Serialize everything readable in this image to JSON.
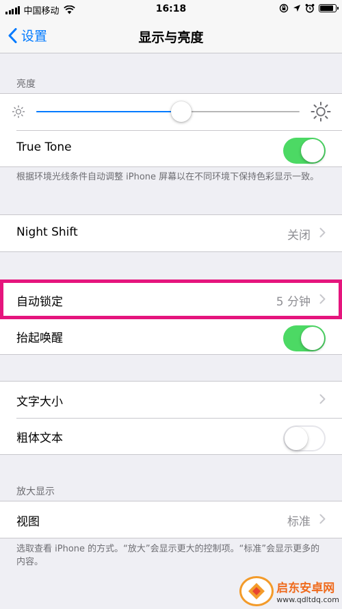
{
  "status_bar": {
    "carrier": "中国移动",
    "time": "16:18"
  },
  "nav": {
    "back_label": "设置",
    "title": "显示与亮度"
  },
  "brightness": {
    "header": "亮度",
    "level": 0.55,
    "true_tone_label": "True Tone",
    "true_tone_on": true,
    "footer": "根据环境光线条件自动调整 iPhone 屏幕以在不同环境下保持色彩显示一致。"
  },
  "night_shift": {
    "label": "Night Shift",
    "value": "关闭"
  },
  "lock": {
    "auto_lock_label": "自动锁定",
    "auto_lock_value": "5 分钟",
    "raise_to_wake_label": "抬起唤醒",
    "raise_to_wake_on": true
  },
  "text": {
    "text_size_label": "文字大小",
    "bold_text_label": "粗体文本",
    "bold_text_on": false
  },
  "zoom": {
    "header": "放大显示",
    "view_label": "视图",
    "view_value": "标准",
    "footer": "选取查看 iPhone 的方式。“放大”会显示更大的控制项。“标准”会显示更多的内容。"
  },
  "watermark": {
    "name": "启东安卓网",
    "url": "www.qdltdq.com"
  },
  "colors": {
    "accent": "#007aff",
    "switch_on": "#4cd964",
    "highlight": "#e5157d",
    "background": "#efeff4"
  },
  "icons": {
    "back": "chevron-left-icon",
    "disclosure": "chevron-right-icon",
    "brightness_low": "sun-small-icon",
    "brightness_high": "sun-large-icon",
    "wifi": "wifi-icon",
    "alarm": "alarm-clock-icon",
    "location": "location-arrow-icon",
    "rotation_lock": "rotation-lock-icon",
    "battery": "battery-icon"
  }
}
